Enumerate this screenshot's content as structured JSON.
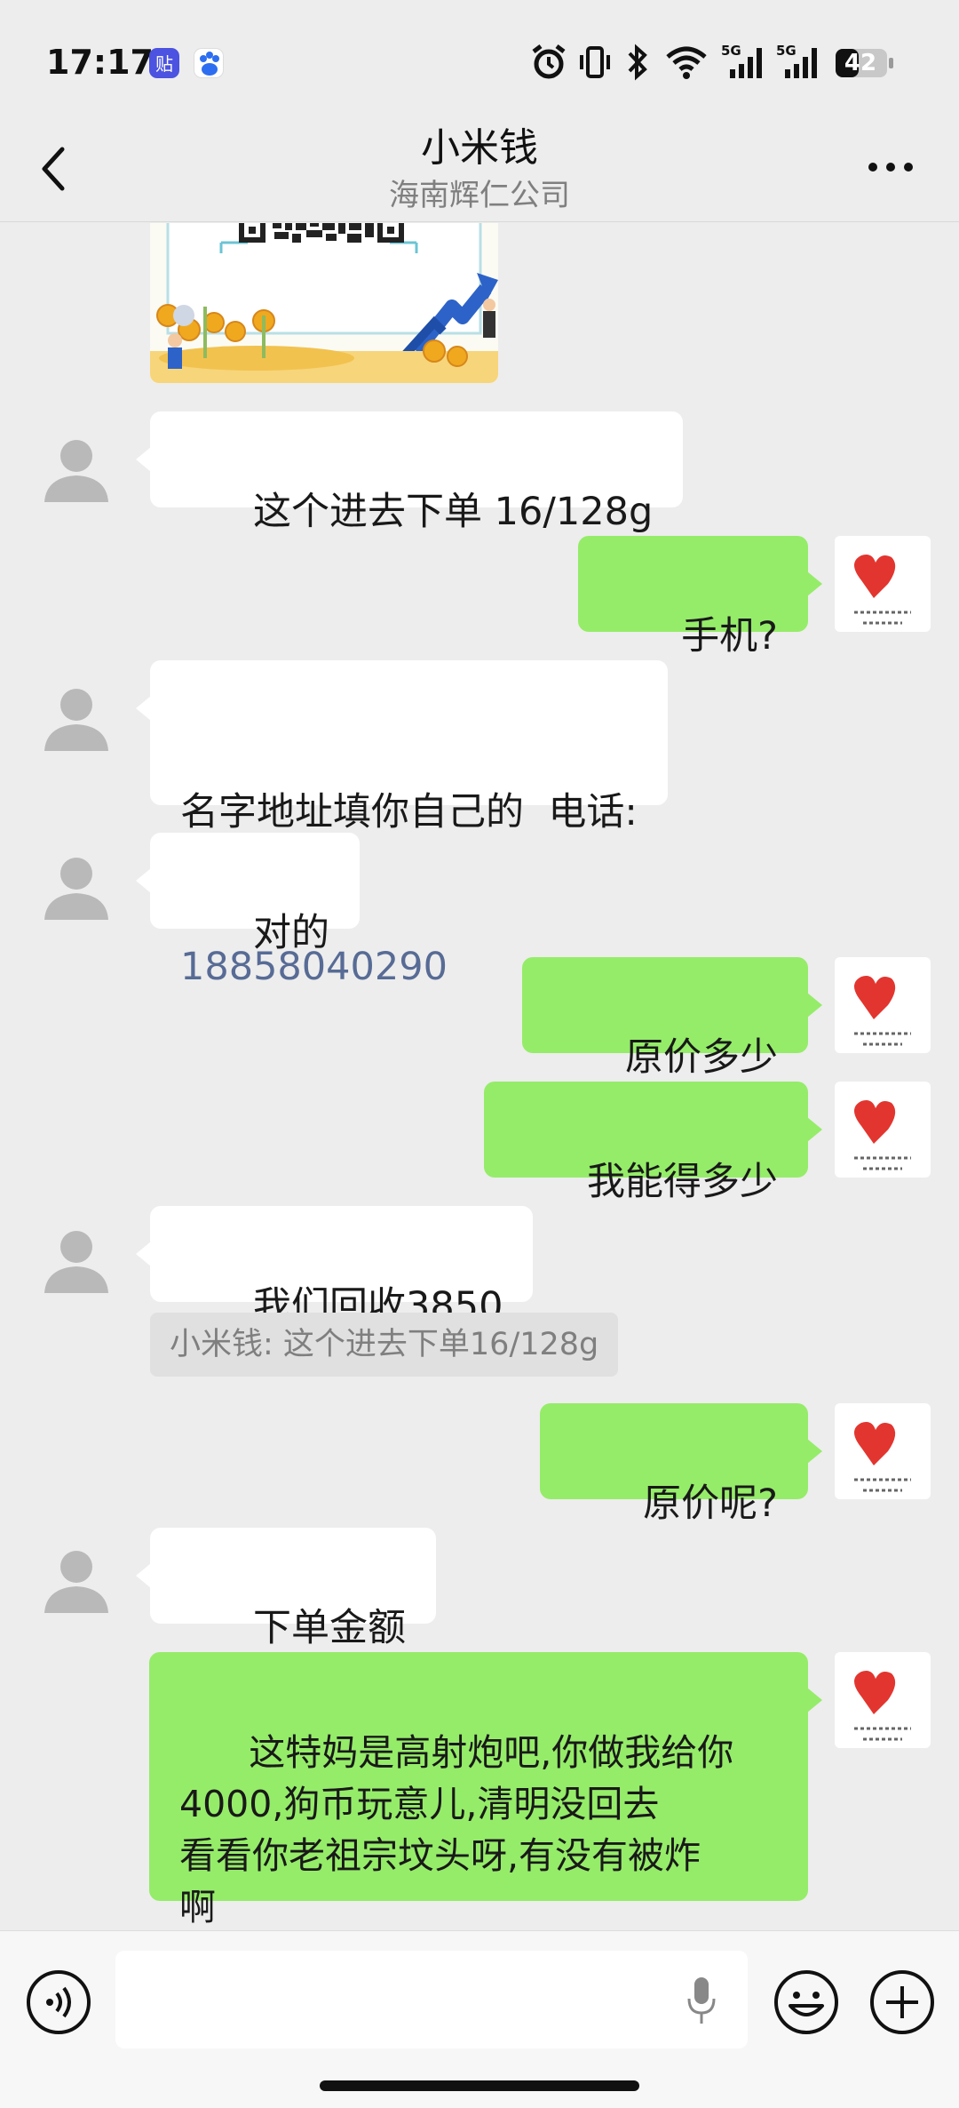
{
  "status_bar": {
    "time": "17:17",
    "battery": "42",
    "icons": [
      "tieba-app-icon",
      "baidu-app-icon",
      "alarm-icon",
      "vibrate-icon",
      "bluetooth-icon",
      "wifi-icon",
      "signal-5g-icon",
      "signal-5g-icon",
      "battery-icon"
    ]
  },
  "header": {
    "title": "小米钱",
    "subtitle": "海南辉仁公司"
  },
  "messages": [
    {
      "from": "other",
      "text": "这个进去下单 16/128g"
    },
    {
      "from": "me",
      "text": "手机?"
    },
    {
      "from": "other",
      "text_line1": "名字地址填你自己的  电话:",
      "phone": "18858040290"
    },
    {
      "from": "other",
      "text": "对的"
    },
    {
      "from": "me",
      "text": "原价多少"
    },
    {
      "from": "me",
      "text": "我能得多少"
    },
    {
      "from": "other",
      "text": "我们回收3850"
    },
    {
      "from": "quote",
      "text": "小米钱: 这个进去下单16/128g"
    },
    {
      "from": "me",
      "text": "原价呢?"
    },
    {
      "from": "other",
      "text": "下单金额"
    },
    {
      "from": "me",
      "text": "这特妈是高射炮吧,你做我给你\n4000,狗币玩意儿,清明没回去\n看看你老祖宗坟头呀,有没有被炸\n啊"
    }
  ],
  "input": {
    "placeholder": ""
  },
  "colors": {
    "background": "#ededed",
    "my_bubble": "#95ec69",
    "other_bubble": "#ffffff",
    "link": "#576b95"
  }
}
